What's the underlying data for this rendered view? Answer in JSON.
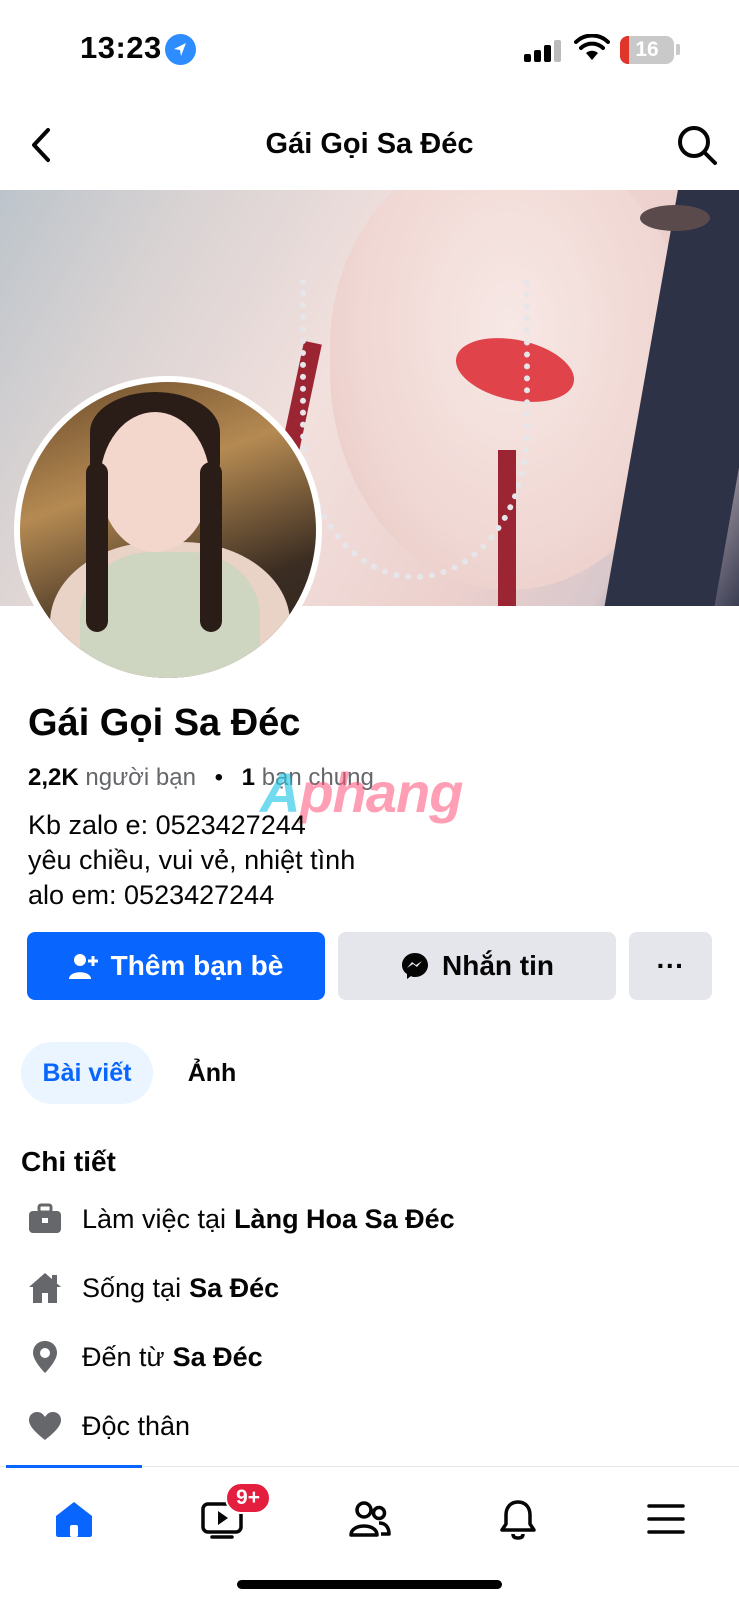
{
  "status_bar": {
    "time": "13:23",
    "battery": "16",
    "icons": [
      "location-arrow-icon",
      "signal-icon",
      "wifi-icon",
      "battery-icon"
    ]
  },
  "header": {
    "title": "Gái Gọi Sa Đéc",
    "icons": [
      "back-chevron-icon",
      "search-icon"
    ]
  },
  "profile": {
    "name": "Gái Gọi Sa Đéc",
    "friends_count": "2,2K",
    "friends_label": "người bạn",
    "separator": "•",
    "mutual_count": "1",
    "mutual_label": "bạn chung",
    "bio_lines": [
      "Kb zalo e: 0523427244",
      "yêu chiều, vui vẻ, nhiệt tình",
      "alo em: 0523427244"
    ],
    "watermark_a": "A",
    "watermark_b": "phang"
  },
  "actions": {
    "add_friend": "Thêm bạn bè",
    "message": "Nhắn tin",
    "more": "···"
  },
  "tabs": [
    {
      "label": "Bài viết",
      "active": true
    },
    {
      "label": "Ảnh",
      "active": false
    }
  ],
  "details": {
    "title": "Chi tiết",
    "work_prefix": "Làm việc tại",
    "work_value": "Làng Hoa Sa Đéc",
    "live_prefix": "Sống tại",
    "live_value": "Sa Đéc",
    "from_prefix": "Đến từ",
    "from_value": "Sa Đéc",
    "relationship": "Độc thân"
  },
  "bottom_nav": {
    "items": [
      "home-icon",
      "video-icon",
      "friends-icon",
      "notifications-icon",
      "menu-icon"
    ],
    "video_badge": "9+"
  },
  "colors": {
    "accent": "#0866ff",
    "secondary_button": "#e4e6eb",
    "badge": "#e41e3f",
    "text": "#050505",
    "muted": "#65676b"
  }
}
